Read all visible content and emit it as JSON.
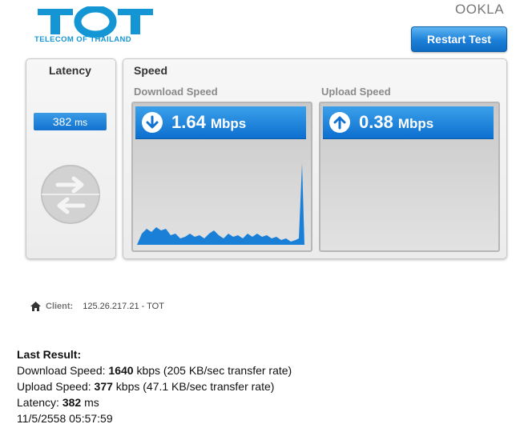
{
  "header": {
    "logo_text": "TOT",
    "logo_subtitle": "TELECOM OF THAILAND",
    "brand": "OOKLA",
    "restart_label": "Restart Test"
  },
  "latency": {
    "title": "Latency",
    "value": "382",
    "unit": "ms"
  },
  "speed": {
    "title": "Speed",
    "download": {
      "label": "Download Speed",
      "value": "1.64",
      "unit": "Mbps"
    },
    "upload": {
      "label": "Upload Speed",
      "value": "0.38",
      "unit": "Mbps"
    }
  },
  "client": {
    "label": "Client:",
    "value": "125.26.217.21 - TOT"
  },
  "last_result": {
    "heading": "Last Result:",
    "download_prefix": "Download Speed:",
    "download_kbps": "1640",
    "download_suffix": "kbps (205 KB/sec transfer rate)",
    "upload_prefix": "Upload Speed:",
    "upload_kbps": "377",
    "upload_suffix": "kbps (47.1 KB/sec transfer rate)",
    "latency_prefix": "Latency:",
    "latency_ms": "382",
    "latency_suffix": "ms",
    "timestamp": "11/5/2558 05:57:59"
  },
  "colors": {
    "accent_blue": "#1272cf",
    "logo_blue": "#1496d4"
  }
}
